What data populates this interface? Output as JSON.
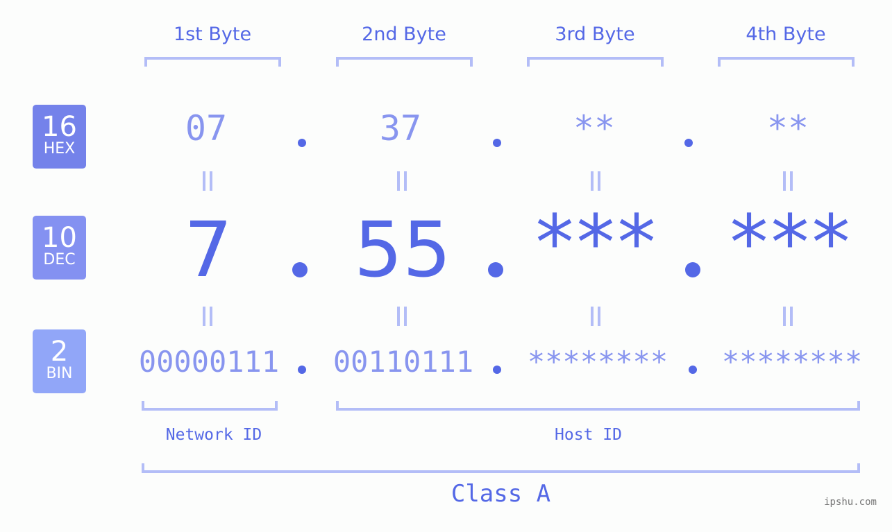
{
  "byte_headers": [
    "1st Byte",
    "2nd Byte",
    "3rd Byte",
    "4th Byte"
  ],
  "bases": [
    {
      "number": "16",
      "label": "HEX",
      "color": "#7482ea"
    },
    {
      "number": "10",
      "label": "DEC",
      "color": "#8491f1"
    },
    {
      "number": "2",
      "label": "BIN",
      "color": "#91a6f8"
    }
  ],
  "hex": [
    "07",
    "37",
    "**",
    "**"
  ],
  "dec": [
    "7",
    "55",
    "***",
    "***"
  ],
  "bin": [
    "00000111",
    "00110111",
    "********",
    "********"
  ],
  "separator": ".",
  "network_label": "Network ID",
  "host_label": "Host ID",
  "class_label": "Class A",
  "watermark": "ipshu.com",
  "colors": {
    "accent": "#5468e6",
    "light_value": "#8895ef",
    "bracket": "#b3bdf7",
    "background": "#fcfdfc"
  }
}
